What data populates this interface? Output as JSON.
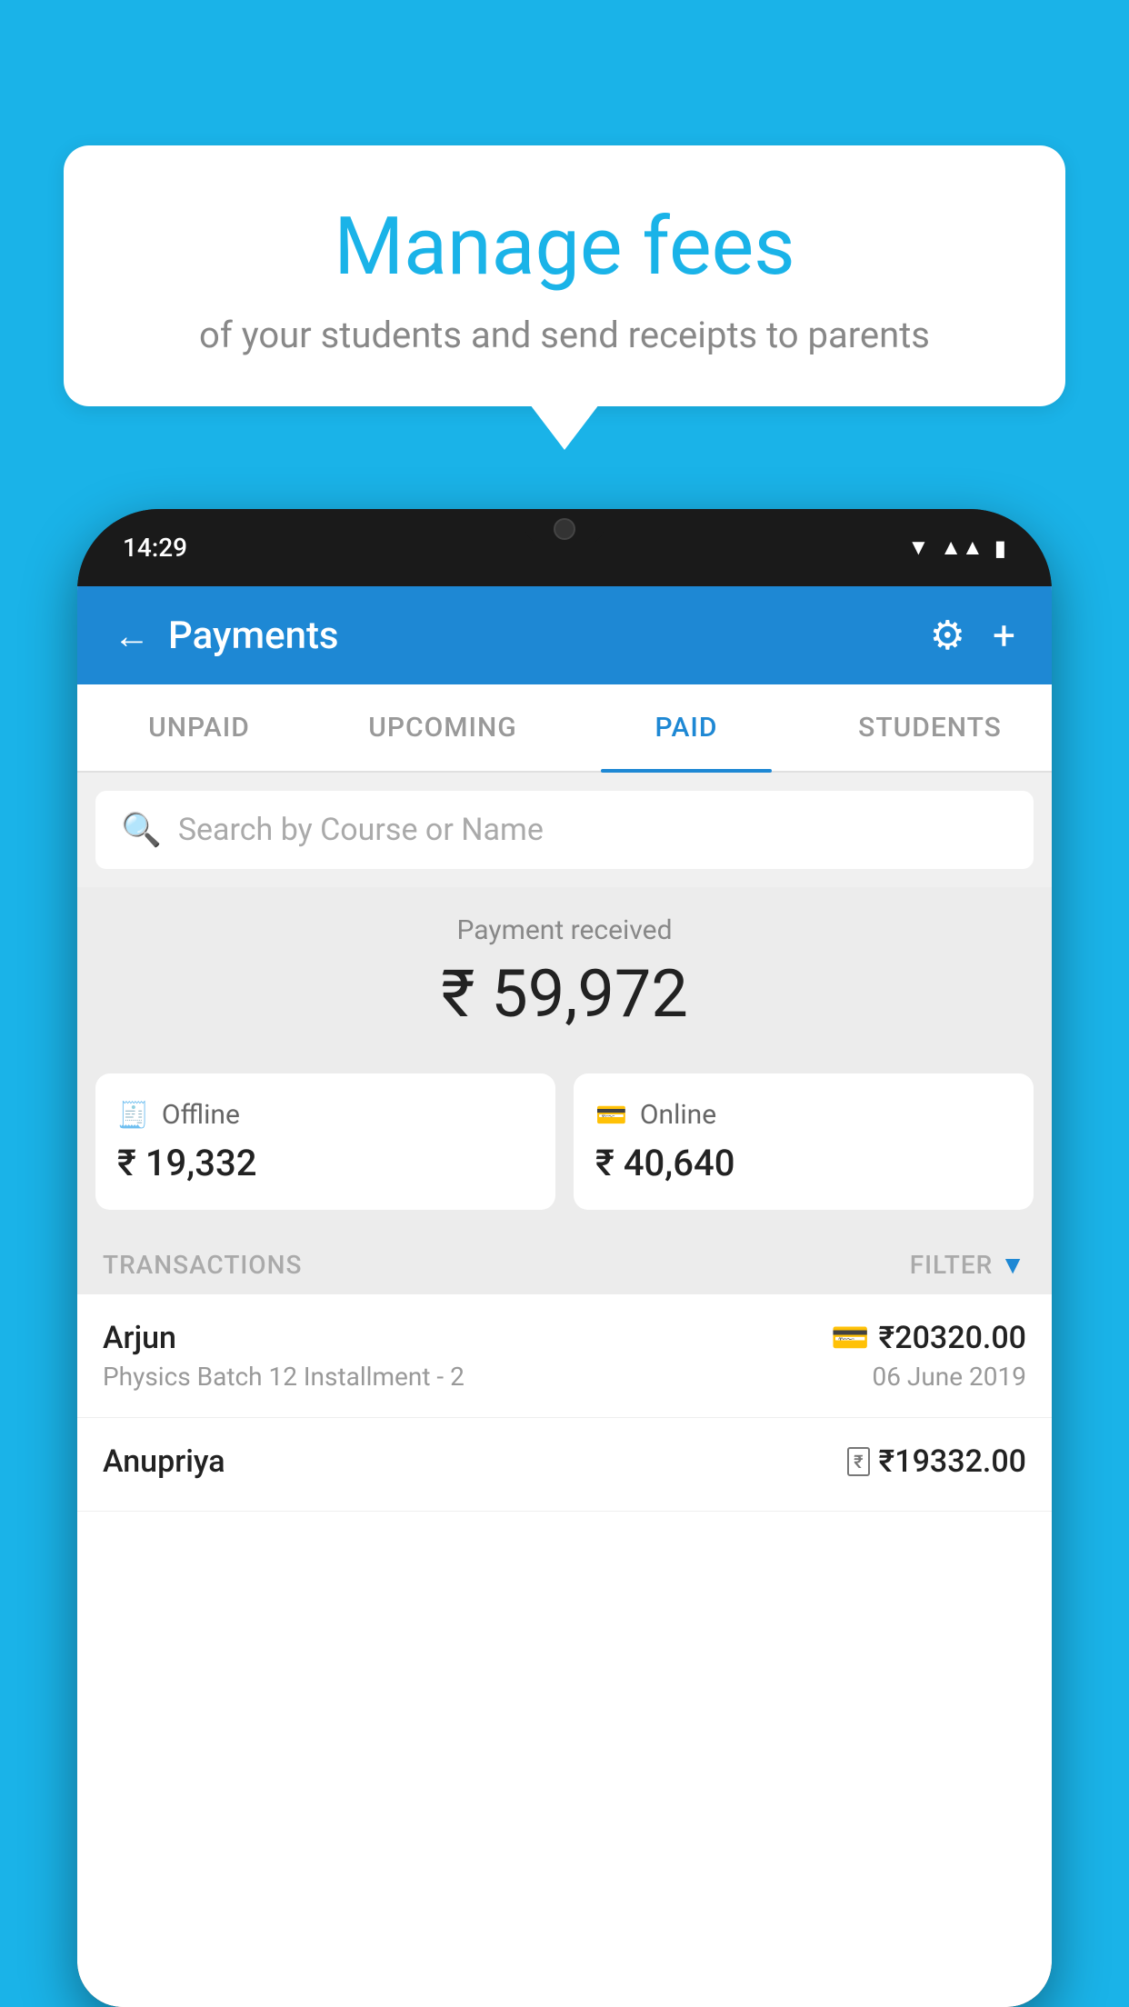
{
  "background_color": "#1ab3e8",
  "speech_bubble": {
    "title": "Manage fees",
    "subtitle": "of your students and send receipts to parents"
  },
  "phone": {
    "status_bar": {
      "time": "14:29"
    },
    "header": {
      "title": "Payments",
      "back_label": "←",
      "gear_label": "⚙",
      "plus_label": "+"
    },
    "tabs": [
      {
        "label": "UNPAID",
        "active": false
      },
      {
        "label": "UPCOMING",
        "active": false
      },
      {
        "label": "PAID",
        "active": true
      },
      {
        "label": "STUDENTS",
        "active": false
      }
    ],
    "search": {
      "placeholder": "Search by Course or Name"
    },
    "payment_summary": {
      "label": "Payment received",
      "amount": "₹ 59,972",
      "offline": {
        "label": "Offline",
        "amount": "₹ 19,332"
      },
      "online": {
        "label": "Online",
        "amount": "₹ 40,640"
      }
    },
    "transactions": {
      "header_label": "TRANSACTIONS",
      "filter_label": "FILTER",
      "items": [
        {
          "name": "Arjun",
          "detail": "Physics Batch 12 Installment - 2",
          "amount": "₹20320.00",
          "date": "06 June 2019",
          "payment_type": "card"
        },
        {
          "name": "Anupriya",
          "detail": "",
          "amount": "₹19332.00",
          "date": "",
          "payment_type": "cash"
        }
      ]
    }
  }
}
